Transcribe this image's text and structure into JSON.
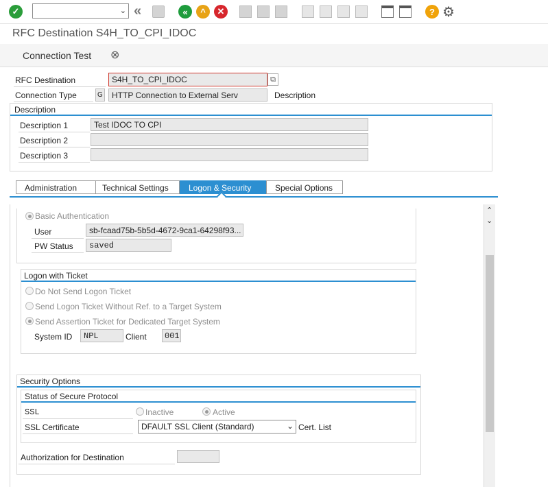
{
  "toolbar": {
    "command_value": "",
    "icons": [
      "enter-icon",
      "back-icon",
      "save-icon",
      "back-green-icon",
      "exit-icon",
      "cancel-icon",
      "print-icon",
      "find-icon",
      "find-next-icon",
      "first-page-icon",
      "prev-page-icon",
      "next-page-icon",
      "last-page-icon",
      "new-session-icon",
      "shortcut-icon",
      "help-icon",
      "settings-icon"
    ]
  },
  "title": "RFC Destination S4H_TO_CPI_IDOC",
  "app_toolbar": {
    "connection_test": "Connection Test"
  },
  "header": {
    "rfc_destination_label": "RFC Destination",
    "rfc_destination_value": "S4H_TO_CPI_IDOC",
    "connection_type_label": "Connection Type",
    "connection_type_code": "G",
    "connection_type_text": "HTTP Connection to External Serv",
    "description_label": "Description"
  },
  "description_group": {
    "title": "Description",
    "d1_label": "Description 1",
    "d1_value": "Test IDOC TO CPI",
    "d2_label": "Description 2",
    "d2_value": "",
    "d3_label": "Description 3",
    "d3_value": ""
  },
  "tabs": [
    {
      "label": "Administration"
    },
    {
      "label": "Technical Settings"
    },
    {
      "label": "Logon & Security"
    },
    {
      "label": "Special Options"
    }
  ],
  "logon": {
    "basic_auth": "Basic Authentication",
    "user_label": "User",
    "user_value": "sb-fcaad75b-5b5d-4672-9ca1-64298f93...",
    "pw_label": "PW Status",
    "pw_value": "saved"
  },
  "ticket": {
    "title": "Logon with Ticket",
    "opt1": "Do Not Send Logon Ticket",
    "opt2": "Send Logon Ticket Without Ref. to a Target System",
    "opt3": "Send Assertion Ticket for Dedicated Target System",
    "system_id_label": "System ID",
    "system_id_value": "NPL",
    "client_label": "Client",
    "client_value": "001"
  },
  "security": {
    "title": "Security Options",
    "status_title": "Status of Secure Protocol",
    "ssl_label": "SSL",
    "inactive": "Inactive",
    "active": "Active",
    "cert_label": "SSL Certificate",
    "cert_value": "DFAULT SSL Client (Standard)",
    "cert_list": "Cert. List",
    "auth_label": "Authorization for Destination",
    "auth_value": ""
  }
}
